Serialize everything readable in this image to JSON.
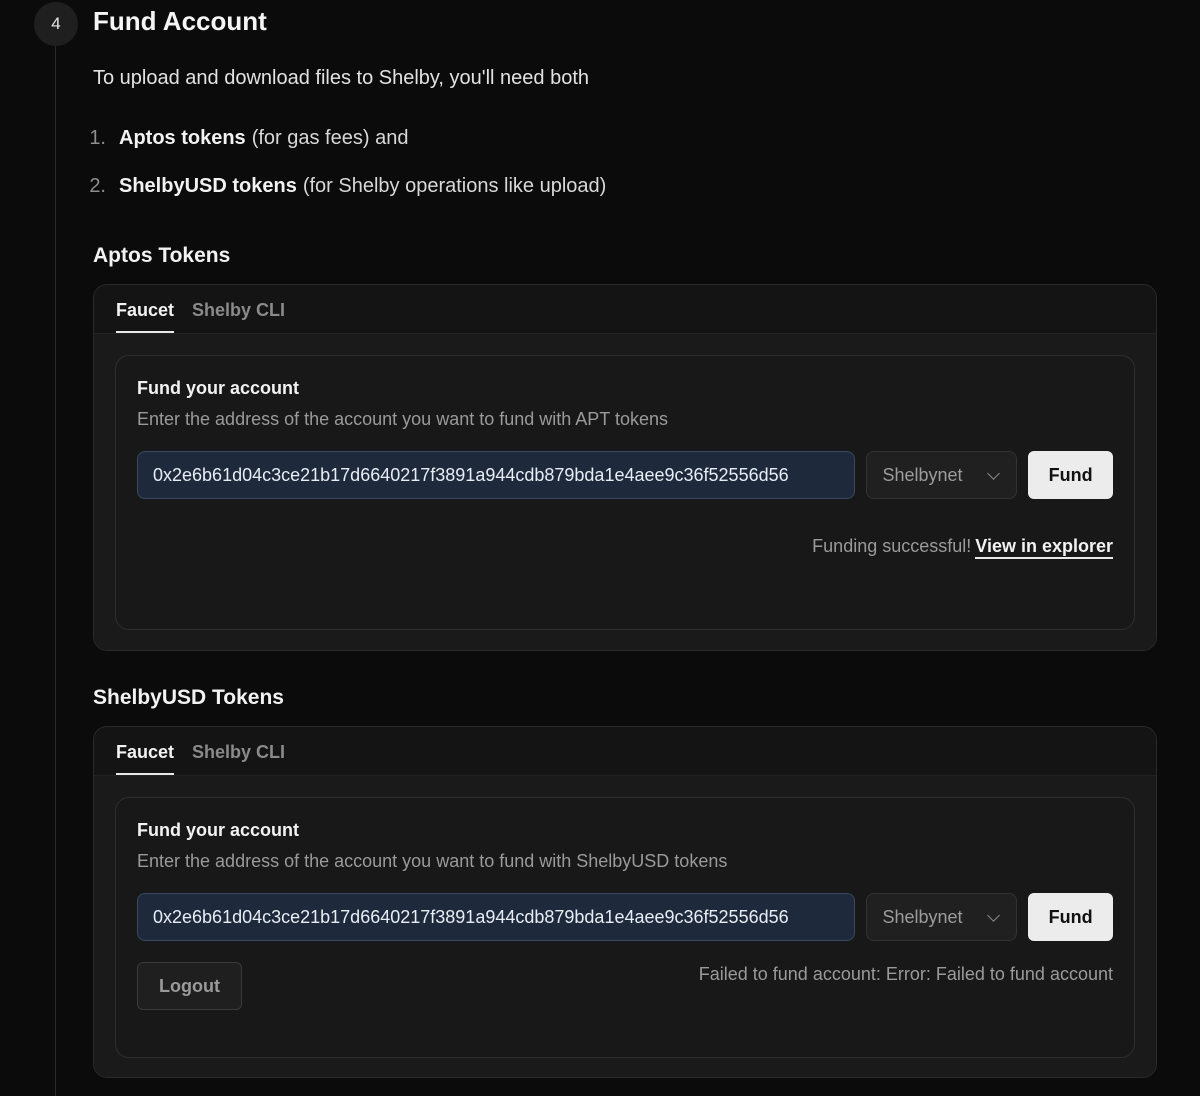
{
  "step": {
    "number": "4",
    "title": "Fund Account",
    "intro": "To upload and download files to Shelby, you'll need both"
  },
  "requirements": [
    {
      "num": "1.",
      "strong": "Aptos tokens",
      "rest": "(for gas fees) and"
    },
    {
      "num": "2.",
      "strong": "ShelbyUSD tokens",
      "rest": "(for Shelby operations like upload)"
    }
  ],
  "aptos": {
    "section_title": "Aptos Tokens",
    "tabs": [
      {
        "label": "Faucet",
        "active": true
      },
      {
        "label": "Shelby CLI",
        "active": false
      }
    ],
    "form_title": "Fund your account",
    "form_desc": "Enter the address of the account you want to fund with APT tokens",
    "address_value": "0x2e6b61d04c3ce21b17d6640217f3891a944cdb879bda1e4aee9c36f52556d56",
    "network": "Shelbynet",
    "fund_label": "Fund",
    "status_text": "Funding successful!",
    "status_link": "View in explorer"
  },
  "shelbyusd": {
    "section_title": "ShelbyUSD Tokens",
    "tabs": [
      {
        "label": "Faucet",
        "active": true
      },
      {
        "label": "Shelby CLI",
        "active": false
      }
    ],
    "form_title": "Fund your account",
    "form_desc": "Enter the address of the account you want to fund with ShelbyUSD tokens",
    "address_value": "0x2e6b61d04c3ce21b17d6640217f3891a944cdb879bda1e4aee9c36f52556d56",
    "network": "Shelbynet",
    "fund_label": "Fund",
    "logout_label": "Logout",
    "status_text": "Failed to fund account: Error: Failed to fund account"
  }
}
